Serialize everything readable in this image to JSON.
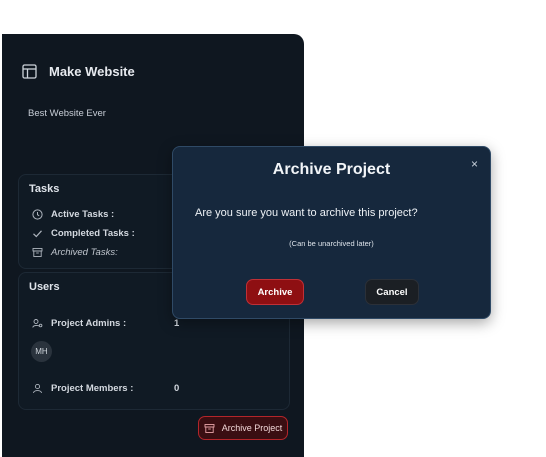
{
  "project": {
    "title": "Make Website",
    "description": "Best Website Ever"
  },
  "tasks": {
    "heading": "Tasks",
    "active_label": "Active Tasks :",
    "completed_label": "Completed Tasks :",
    "archived_label": "Archived Tasks:"
  },
  "users": {
    "heading": "Users",
    "admins_label": "Project Admins :",
    "admins_count": "1",
    "admin_avatar": "MH",
    "members_label": "Project Members :",
    "members_count": "0"
  },
  "actions": {
    "archive_project_label": "Archive Project"
  },
  "modal": {
    "title": "Archive Project",
    "close_glyph": "×",
    "message": "Are you sure you want to archive this project?",
    "subtext": "(Can be unarchived later)",
    "confirm_label": "Archive",
    "cancel_label": "Cancel"
  },
  "icons": {
    "project": "layout-icon",
    "active": "clock-icon",
    "completed": "check-icon",
    "archived": "archive-icon",
    "admins": "user-cog-icon",
    "members": "user-icon",
    "close": "close-icon"
  },
  "colors": {
    "panel_bg": "#0f1720",
    "modal_bg": "#16283d",
    "danger": "#8e0f12",
    "danger_border": "#b4252a"
  }
}
